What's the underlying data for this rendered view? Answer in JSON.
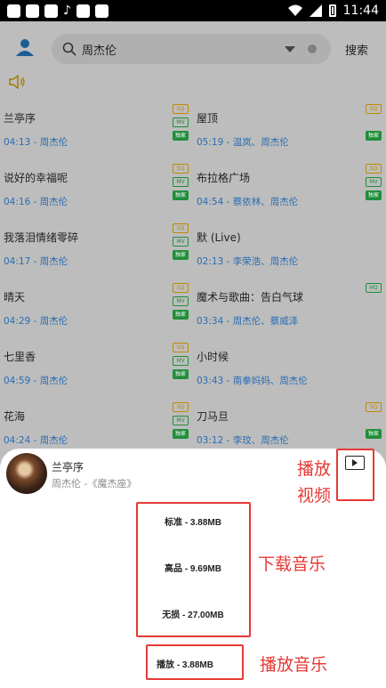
{
  "status_bar": {
    "time": "11:44"
  },
  "search": {
    "query": "周杰伦",
    "button_label": "搜索"
  },
  "songs": [
    {
      "title": "兰亭序",
      "time": "04:13",
      "artist": "周杰伦"
    },
    {
      "title": "屋顶",
      "time": "05:19",
      "artist": "温岚、周杰伦"
    },
    {
      "title": "说好的幸福呢",
      "time": "04:16",
      "artist": "周杰伦"
    },
    {
      "title": "布拉格广场",
      "time": "04:54",
      "artist": "蔡依林、周杰伦"
    },
    {
      "title": "我落泪情绪零碎",
      "time": "04:17",
      "artist": "周杰伦"
    },
    {
      "title": "默 (Live)",
      "time": "02:13",
      "artist": "李荣浩、周杰伦"
    },
    {
      "title": "晴天",
      "time": "04:29",
      "artist": "周杰伦"
    },
    {
      "title": "魔术与歌曲：告白气球",
      "time": "03:34",
      "artist": "周杰伦、蔡威泽"
    },
    {
      "title": "七里香",
      "time": "04:59",
      "artist": "周杰伦"
    },
    {
      "title": "小时候",
      "time": "03:43",
      "artist": "南拳妈妈、周杰伦"
    },
    {
      "title": "花海",
      "time": "04:24",
      "artist": "周杰伦"
    },
    {
      "title": "刀马旦",
      "time": "03:12",
      "artist": "李玟、周杰伦"
    }
  ],
  "badges": {
    "sq": "SQ",
    "mv": "MV",
    "hq": "HQ",
    "ex": "独家"
  },
  "sheet": {
    "song_title": "兰亭序",
    "song_subtitle": "周杰伦 -《魔杰座》",
    "options": {
      "standard": "标准 - 3.88MB",
      "high": "高品 - 9.69MB",
      "lossless": "无损 - 27.00MB",
      "play": "播放 - 3.88MB"
    }
  },
  "annotations": {
    "play_video_line1": "播放",
    "play_video_line2": "视频",
    "download_music": "下载音乐",
    "play_music": "播放音乐"
  },
  "colors": {
    "annotation": "#e53935",
    "link": "#2a6db1",
    "overlay": "#bdbdbd"
  }
}
